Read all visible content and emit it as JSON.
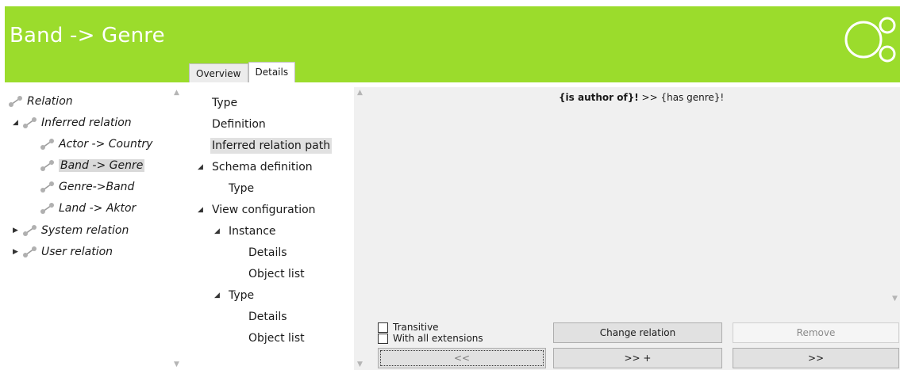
{
  "header": {
    "title": "Band -> Genre",
    "bg_color": "#9bdc2c",
    "logo_icon": "share-nodes-icon"
  },
  "tabs": [
    {
      "label": "Overview",
      "active": false
    },
    {
      "label": "Details",
      "active": true
    }
  ],
  "left_tree": {
    "items": [
      {
        "label": "Relation"
      },
      {
        "label": "Inferred relation"
      },
      {
        "label": "Actor -> Country"
      },
      {
        "label": "Band -> Genre"
      },
      {
        "label": "Genre->Band"
      },
      {
        "label": "Land -> Aktor"
      },
      {
        "label": "System relation"
      },
      {
        "label": "User relation"
      }
    ]
  },
  "mid_tree": {
    "items": [
      {
        "label": "Type"
      },
      {
        "label": "Definition"
      },
      {
        "label": "Inferred relation path"
      },
      {
        "label": "Schema definition"
      },
      {
        "label": "Type"
      },
      {
        "label": "View configuration"
      },
      {
        "label": "Instance"
      },
      {
        "label": "Details"
      },
      {
        "label": "Object list"
      },
      {
        "label": "Type"
      },
      {
        "label": "Details"
      },
      {
        "label": "Object list"
      }
    ]
  },
  "path": {
    "bold_part": "{is author of}!",
    "rest": " >> {has genre}!"
  },
  "options": {
    "transitive": "Transitive",
    "all_extensions": "With all extensions"
  },
  "buttons": {
    "change_relation": "Change relation",
    "remove": "Remove",
    "back": "<<",
    "forward_plus": ">> +",
    "forward": ">>"
  }
}
